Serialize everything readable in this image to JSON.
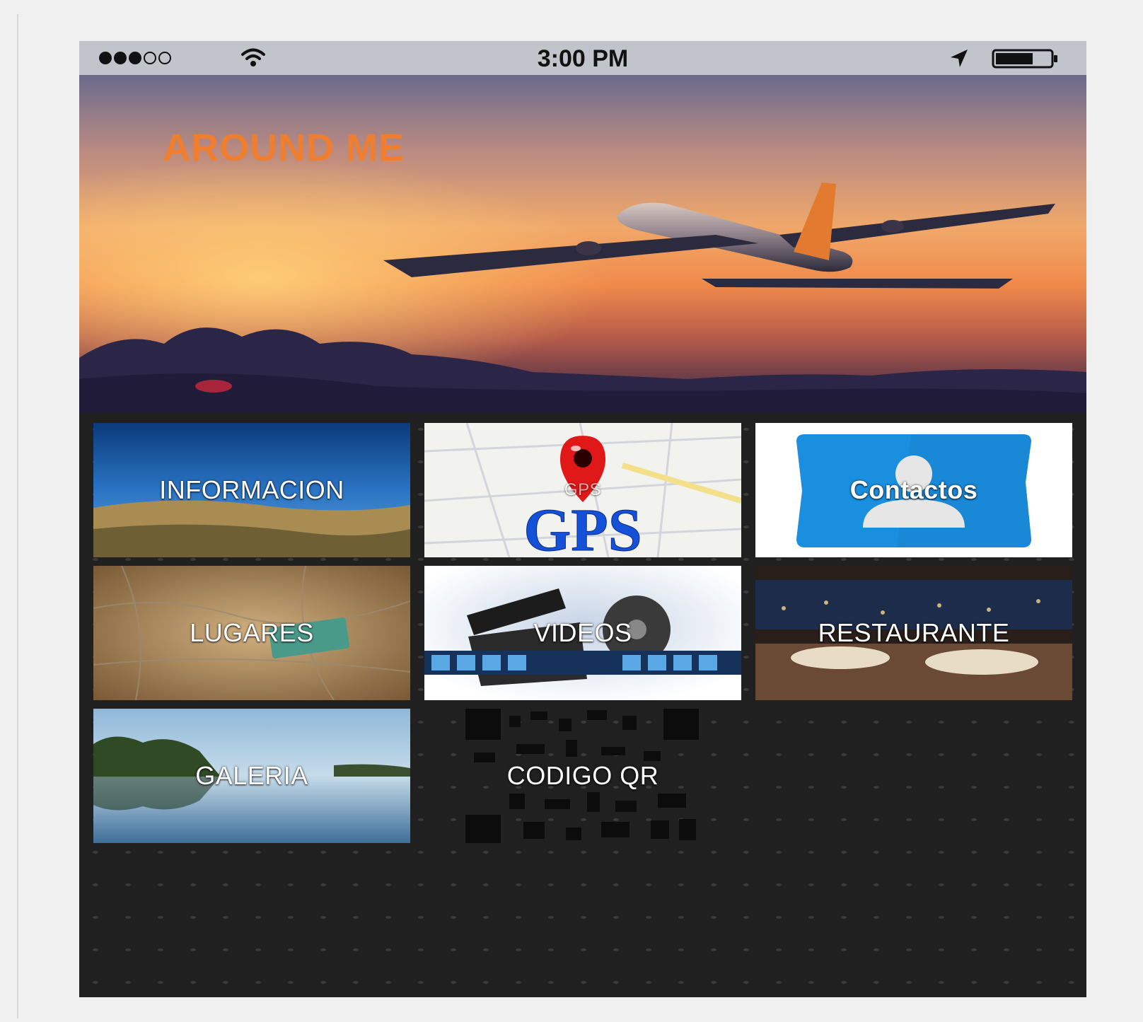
{
  "status_bar": {
    "time": "3:00 PM",
    "signal_filled": 3,
    "signal_empty": 2,
    "battery_level": 0.65
  },
  "hero": {
    "title": "AROUND ME"
  },
  "menu": {
    "tiles": [
      {
        "label": "INFORMACION",
        "icon": "coast-photo"
      },
      {
        "label": "GPS",
        "icon": "map-pin-icon"
      },
      {
        "label": "Contactos",
        "icon": "contact-person-icon"
      },
      {
        "label": "LUGARES",
        "icon": "map-photo"
      },
      {
        "label": "VIDEOS",
        "icon": "film-clapper-icon"
      },
      {
        "label": "RESTAURANTE",
        "icon": "restaurant-photo"
      },
      {
        "label": "GALERIA",
        "icon": "lake-photo"
      },
      {
        "label": "CODIGO QR",
        "icon": "qr-code-icon"
      }
    ],
    "tile_gps_caption": "GPS"
  },
  "colors": {
    "title_orange": "#ef7e2e",
    "status_bar": "#c2c4cb",
    "menu_bg": "#202020",
    "contact_blue": "#1a8fe0"
  }
}
